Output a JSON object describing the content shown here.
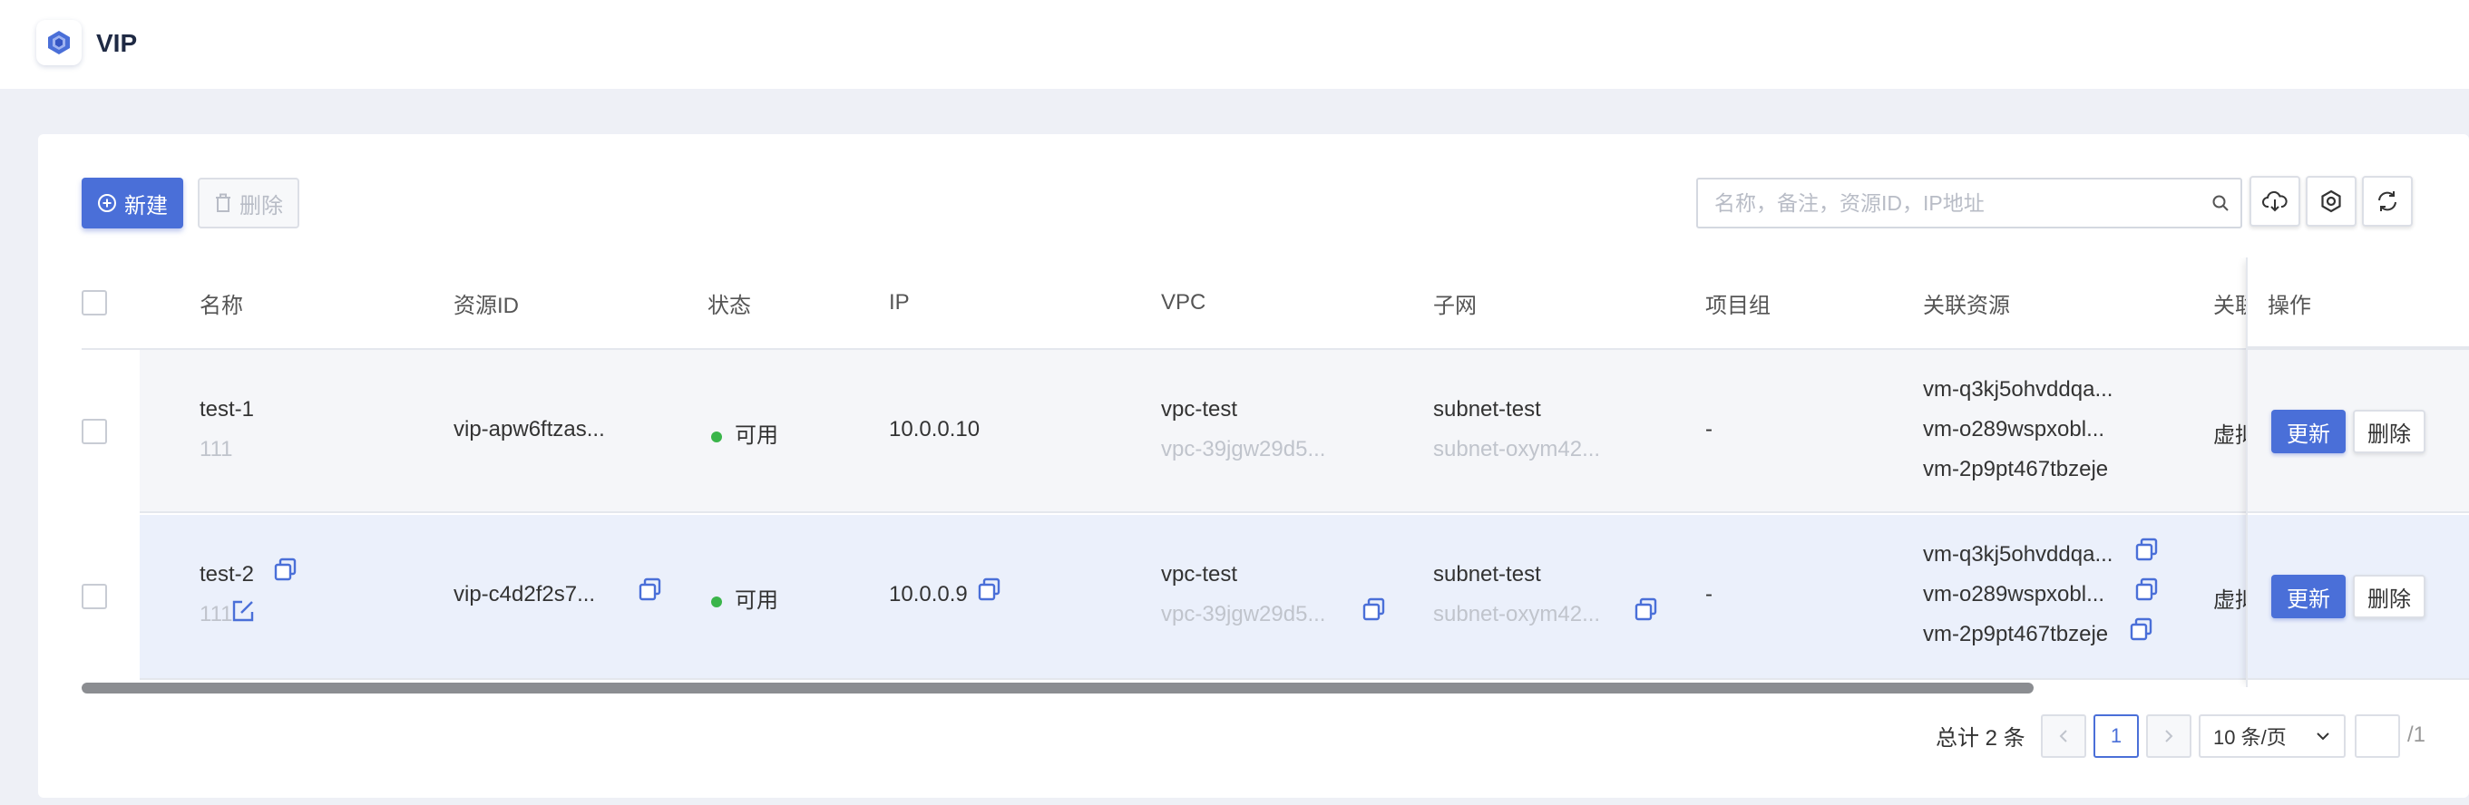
{
  "header": {
    "title": "VIP"
  },
  "toolbar": {
    "new_label": "新建",
    "delete_label": "删除",
    "search_placeholder": "名称，备注，资源ID，IP地址"
  },
  "table": {
    "columns": [
      "名称",
      "资源ID",
      "状态",
      "IP",
      "VPC",
      "子网",
      "项目组",
      "关联资源",
      "关联",
      "操作"
    ],
    "rows": [
      {
        "name": "test-1",
        "remark": "111",
        "resource_id": "vip-apw6ftzas...",
        "status": "可用",
        "ip": "10.0.0.10",
        "vpc_name": "vpc-test",
        "vpc_id": "vpc-39jgw29d5...",
        "subnet_name": "subnet-test",
        "subnet_id": "subnet-oxym42...",
        "project": "-",
        "resources": [
          "vm-q3kj5ohvddqa...",
          "vm-o289wspxobl...",
          "vm-2p9pt467tbzeje"
        ],
        "assoc_type": "虚拟",
        "update_label": "更新",
        "delete_label": "删除"
      },
      {
        "name": "test-2",
        "remark": "111",
        "resource_id": "vip-c4d2f2s7...",
        "status": "可用",
        "ip": "10.0.0.9",
        "vpc_name": "vpc-test",
        "vpc_id": "vpc-39jgw29d5...",
        "subnet_name": "subnet-test",
        "subnet_id": "subnet-oxym42...",
        "project": "-",
        "resources": [
          "vm-q3kj5ohvddqa...",
          "vm-o289wspxobl...",
          "vm-2p9pt467tbzeje"
        ],
        "assoc_type": "虚拟",
        "update_label": "更新",
        "delete_label": "删除"
      }
    ]
  },
  "pagination": {
    "total_label": "总计 2 条",
    "current_page": "1",
    "page_size": "10 条/页",
    "total_pages": "/1"
  },
  "colors": {
    "accent": "#4a6fd8",
    "status_ok": "#3ab54a",
    "selected_row": "#ebf0fb"
  }
}
